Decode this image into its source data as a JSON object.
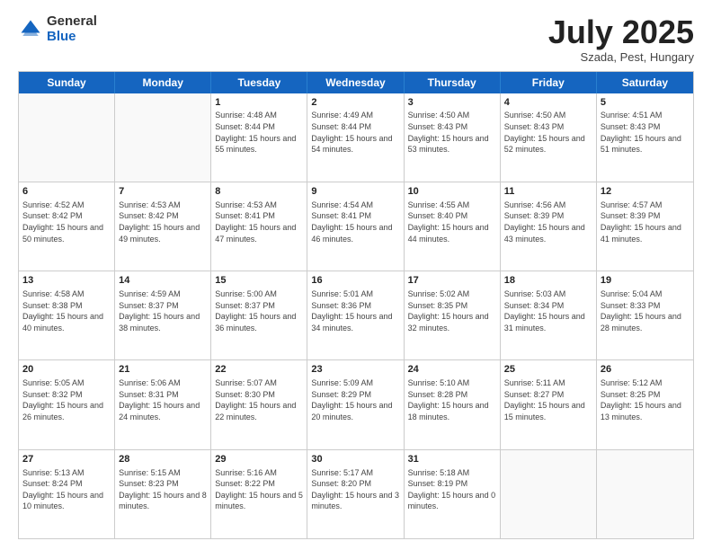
{
  "header": {
    "logo_general": "General",
    "logo_blue": "Blue",
    "month_title": "July 2025",
    "location": "Szada, Pest, Hungary"
  },
  "weekdays": [
    "Sunday",
    "Monday",
    "Tuesday",
    "Wednesday",
    "Thursday",
    "Friday",
    "Saturday"
  ],
  "rows": [
    [
      {
        "day": "",
        "sunrise": "",
        "sunset": "",
        "daylight": "",
        "empty": true
      },
      {
        "day": "",
        "sunrise": "",
        "sunset": "",
        "daylight": "",
        "empty": true
      },
      {
        "day": "1",
        "sunrise": "Sunrise: 4:48 AM",
        "sunset": "Sunset: 8:44 PM",
        "daylight": "Daylight: 15 hours and 55 minutes."
      },
      {
        "day": "2",
        "sunrise": "Sunrise: 4:49 AM",
        "sunset": "Sunset: 8:44 PM",
        "daylight": "Daylight: 15 hours and 54 minutes."
      },
      {
        "day": "3",
        "sunrise": "Sunrise: 4:50 AM",
        "sunset": "Sunset: 8:43 PM",
        "daylight": "Daylight: 15 hours and 53 minutes."
      },
      {
        "day": "4",
        "sunrise": "Sunrise: 4:50 AM",
        "sunset": "Sunset: 8:43 PM",
        "daylight": "Daylight: 15 hours and 52 minutes."
      },
      {
        "day": "5",
        "sunrise": "Sunrise: 4:51 AM",
        "sunset": "Sunset: 8:43 PM",
        "daylight": "Daylight: 15 hours and 51 minutes."
      }
    ],
    [
      {
        "day": "6",
        "sunrise": "Sunrise: 4:52 AM",
        "sunset": "Sunset: 8:42 PM",
        "daylight": "Daylight: 15 hours and 50 minutes."
      },
      {
        "day": "7",
        "sunrise": "Sunrise: 4:53 AM",
        "sunset": "Sunset: 8:42 PM",
        "daylight": "Daylight: 15 hours and 49 minutes."
      },
      {
        "day": "8",
        "sunrise": "Sunrise: 4:53 AM",
        "sunset": "Sunset: 8:41 PM",
        "daylight": "Daylight: 15 hours and 47 minutes."
      },
      {
        "day": "9",
        "sunrise": "Sunrise: 4:54 AM",
        "sunset": "Sunset: 8:41 PM",
        "daylight": "Daylight: 15 hours and 46 minutes."
      },
      {
        "day": "10",
        "sunrise": "Sunrise: 4:55 AM",
        "sunset": "Sunset: 8:40 PM",
        "daylight": "Daylight: 15 hours and 44 minutes."
      },
      {
        "day": "11",
        "sunrise": "Sunrise: 4:56 AM",
        "sunset": "Sunset: 8:39 PM",
        "daylight": "Daylight: 15 hours and 43 minutes."
      },
      {
        "day": "12",
        "sunrise": "Sunrise: 4:57 AM",
        "sunset": "Sunset: 8:39 PM",
        "daylight": "Daylight: 15 hours and 41 minutes."
      }
    ],
    [
      {
        "day": "13",
        "sunrise": "Sunrise: 4:58 AM",
        "sunset": "Sunset: 8:38 PM",
        "daylight": "Daylight: 15 hours and 40 minutes."
      },
      {
        "day": "14",
        "sunrise": "Sunrise: 4:59 AM",
        "sunset": "Sunset: 8:37 PM",
        "daylight": "Daylight: 15 hours and 38 minutes."
      },
      {
        "day": "15",
        "sunrise": "Sunrise: 5:00 AM",
        "sunset": "Sunset: 8:37 PM",
        "daylight": "Daylight: 15 hours and 36 minutes."
      },
      {
        "day": "16",
        "sunrise": "Sunrise: 5:01 AM",
        "sunset": "Sunset: 8:36 PM",
        "daylight": "Daylight: 15 hours and 34 minutes."
      },
      {
        "day": "17",
        "sunrise": "Sunrise: 5:02 AM",
        "sunset": "Sunset: 8:35 PM",
        "daylight": "Daylight: 15 hours and 32 minutes."
      },
      {
        "day": "18",
        "sunrise": "Sunrise: 5:03 AM",
        "sunset": "Sunset: 8:34 PM",
        "daylight": "Daylight: 15 hours and 31 minutes."
      },
      {
        "day": "19",
        "sunrise": "Sunrise: 5:04 AM",
        "sunset": "Sunset: 8:33 PM",
        "daylight": "Daylight: 15 hours and 28 minutes."
      }
    ],
    [
      {
        "day": "20",
        "sunrise": "Sunrise: 5:05 AM",
        "sunset": "Sunset: 8:32 PM",
        "daylight": "Daylight: 15 hours and 26 minutes."
      },
      {
        "day": "21",
        "sunrise": "Sunrise: 5:06 AM",
        "sunset": "Sunset: 8:31 PM",
        "daylight": "Daylight: 15 hours and 24 minutes."
      },
      {
        "day": "22",
        "sunrise": "Sunrise: 5:07 AM",
        "sunset": "Sunset: 8:30 PM",
        "daylight": "Daylight: 15 hours and 22 minutes."
      },
      {
        "day": "23",
        "sunrise": "Sunrise: 5:09 AM",
        "sunset": "Sunset: 8:29 PM",
        "daylight": "Daylight: 15 hours and 20 minutes."
      },
      {
        "day": "24",
        "sunrise": "Sunrise: 5:10 AM",
        "sunset": "Sunset: 8:28 PM",
        "daylight": "Daylight: 15 hours and 18 minutes."
      },
      {
        "day": "25",
        "sunrise": "Sunrise: 5:11 AM",
        "sunset": "Sunset: 8:27 PM",
        "daylight": "Daylight: 15 hours and 15 minutes."
      },
      {
        "day": "26",
        "sunrise": "Sunrise: 5:12 AM",
        "sunset": "Sunset: 8:25 PM",
        "daylight": "Daylight: 15 hours and 13 minutes."
      }
    ],
    [
      {
        "day": "27",
        "sunrise": "Sunrise: 5:13 AM",
        "sunset": "Sunset: 8:24 PM",
        "daylight": "Daylight: 15 hours and 10 minutes."
      },
      {
        "day": "28",
        "sunrise": "Sunrise: 5:15 AM",
        "sunset": "Sunset: 8:23 PM",
        "daylight": "Daylight: 15 hours and 8 minutes."
      },
      {
        "day": "29",
        "sunrise": "Sunrise: 5:16 AM",
        "sunset": "Sunset: 8:22 PM",
        "daylight": "Daylight: 15 hours and 5 minutes."
      },
      {
        "day": "30",
        "sunrise": "Sunrise: 5:17 AM",
        "sunset": "Sunset: 8:20 PM",
        "daylight": "Daylight: 15 hours and 3 minutes."
      },
      {
        "day": "31",
        "sunrise": "Sunrise: 5:18 AM",
        "sunset": "Sunset: 8:19 PM",
        "daylight": "Daylight: 15 hours and 0 minutes."
      },
      {
        "day": "",
        "sunrise": "",
        "sunset": "",
        "daylight": "",
        "empty": true
      },
      {
        "day": "",
        "sunrise": "",
        "sunset": "",
        "daylight": "",
        "empty": true
      }
    ]
  ]
}
